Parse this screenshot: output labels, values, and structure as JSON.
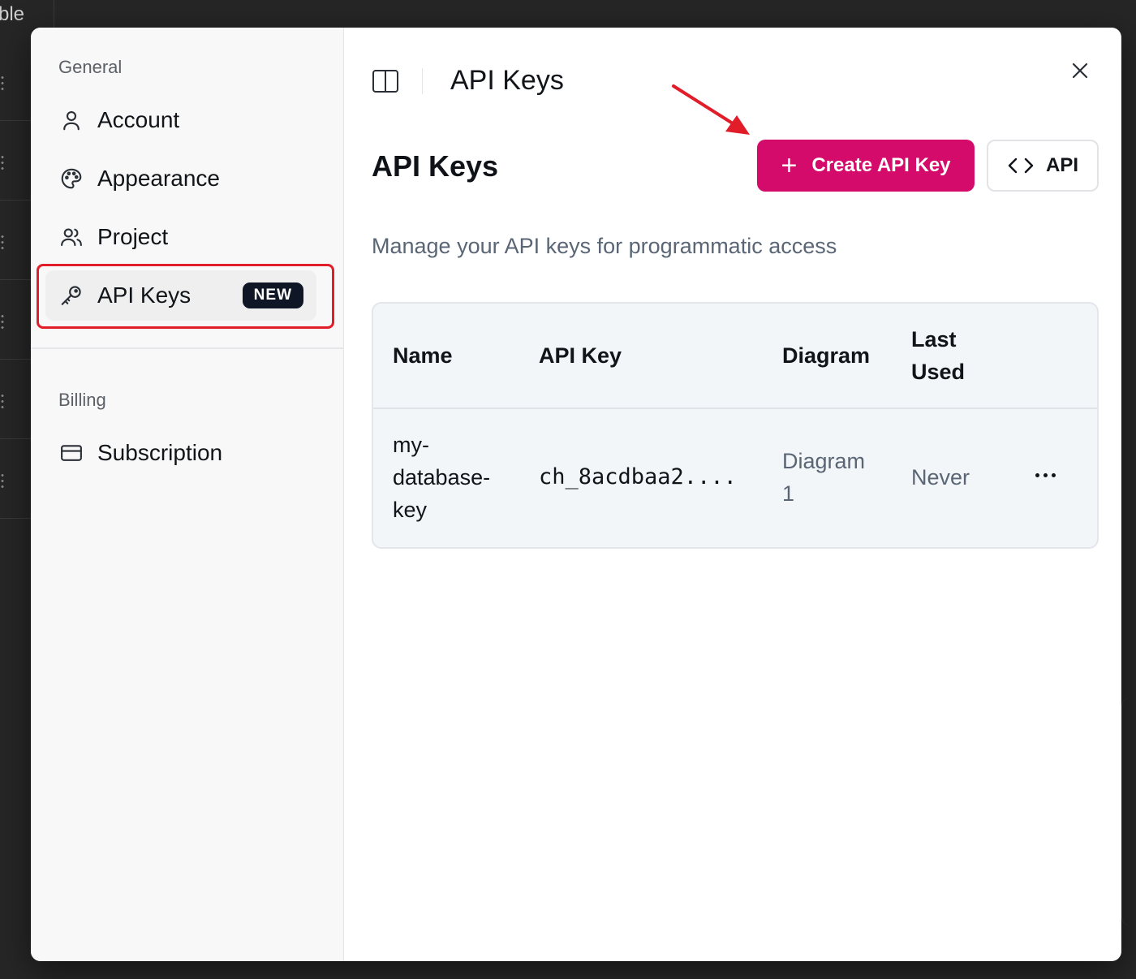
{
  "background": {
    "peek_text": "ble"
  },
  "sidebar": {
    "general_label": "General",
    "items": [
      {
        "label": "Account",
        "icon": "user-icon"
      },
      {
        "label": "Appearance",
        "icon": "palette-icon"
      },
      {
        "label": "Project",
        "icon": "users-icon"
      },
      {
        "label": "API Keys",
        "icon": "key-icon",
        "badge": "NEW",
        "active": true
      }
    ],
    "billing_label": "Billing",
    "billing_items": [
      {
        "label": "Subscription",
        "icon": "credit-card-icon"
      }
    ]
  },
  "header": {
    "title": "API Keys"
  },
  "main": {
    "page_title": "API Keys",
    "create_button": "Create API Key",
    "api_button": "API",
    "subtitle": "Manage your API keys for programmatic access"
  },
  "table": {
    "columns": [
      "Name",
      "API Key",
      "Diagram",
      "Last Used"
    ],
    "rows": [
      {
        "name": "my-database-key",
        "api_key": "ch_8acdbaa2....",
        "diagram": "Diagram 1",
        "last_used": "Never"
      }
    ]
  },
  "colors": {
    "accent": "#d40b6a",
    "highlight": "#e11d2a",
    "badge_bg": "#0f1726"
  }
}
